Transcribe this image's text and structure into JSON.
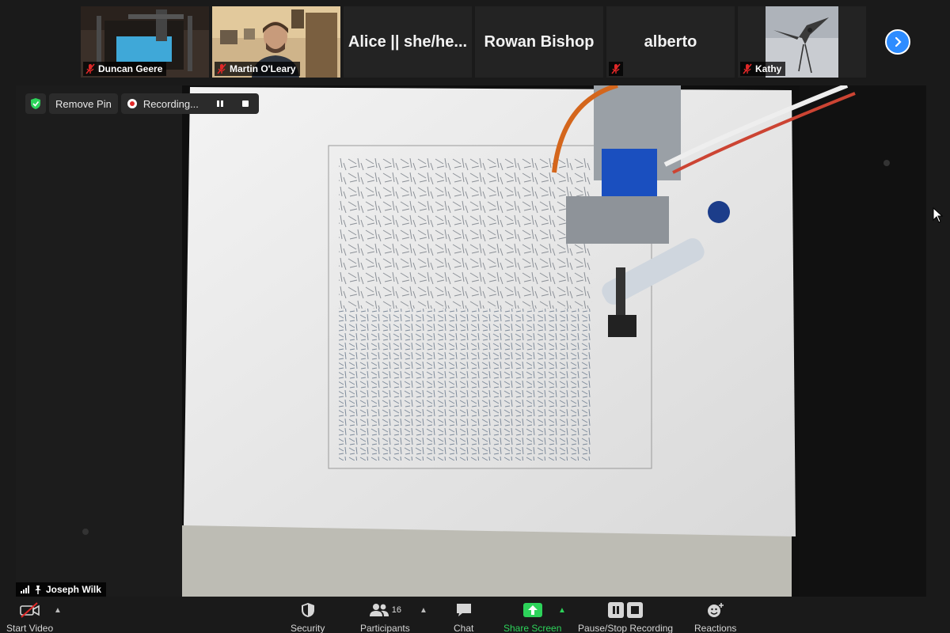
{
  "participants": [
    {
      "name": "Duncan Geere",
      "type": "video",
      "muted": true
    },
    {
      "name": "Martin O'Leary",
      "type": "video",
      "muted": true
    },
    {
      "name": "Alice || she/he...",
      "type": "name",
      "muted": false
    },
    {
      "name": "Rowan Bishop",
      "type": "name",
      "muted": false
    },
    {
      "name": "alberto",
      "type": "name",
      "muted": true
    },
    {
      "name": "Kathy",
      "type": "video",
      "muted": true
    }
  ],
  "pin_bar": {
    "remove_pin": "Remove Pin",
    "recording": "Recording..."
  },
  "active_speaker": "Joseph Wilk",
  "toolbar": {
    "start_video": "Start Video",
    "security": "Security",
    "participants": "Participants",
    "participants_count": "16",
    "chat": "Chat",
    "share_screen": "Share Screen",
    "pause_stop_recording": "Pause/Stop Recording",
    "reactions": "Reactions"
  },
  "colors": {
    "accent": "#2d8cff",
    "share_green": "#2dd35a",
    "recording_red": "#e02828",
    "muted_red": "#e02828"
  },
  "icons": [
    "mic-muted-icon",
    "chevron-right-icon",
    "shield-check-icon",
    "record-icon",
    "pause-icon",
    "stop-icon",
    "signal-icon",
    "pin-icon",
    "video-off-icon",
    "security-shield-icon",
    "participants-icon",
    "chat-icon",
    "share-screen-icon",
    "reactions-icon"
  ]
}
